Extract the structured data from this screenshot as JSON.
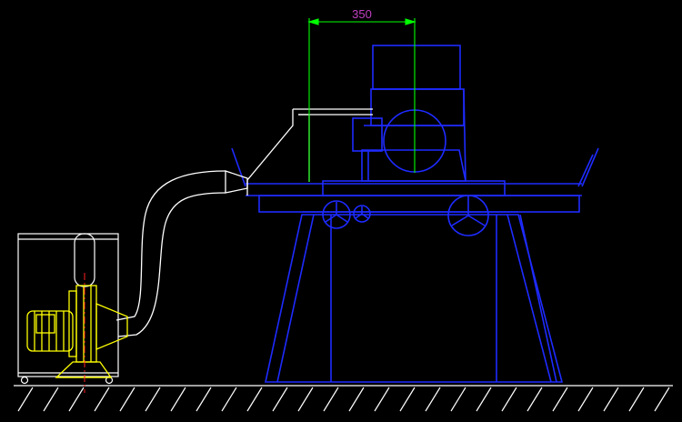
{
  "dimension": {
    "label": "350"
  },
  "colors": {
    "background": "#000000",
    "machine": "#1e2bff",
    "dimension": "#00ff00",
    "dimension_text": "#c040c0",
    "duct": "#ffffff",
    "blower": "#ffff00",
    "centerline": "#ff2020",
    "ground": "#ffffff"
  },
  "components": {
    "grinder": "surface-grinder",
    "blower": "dust-collector-blower",
    "duct": "flexible-suction-duct"
  }
}
